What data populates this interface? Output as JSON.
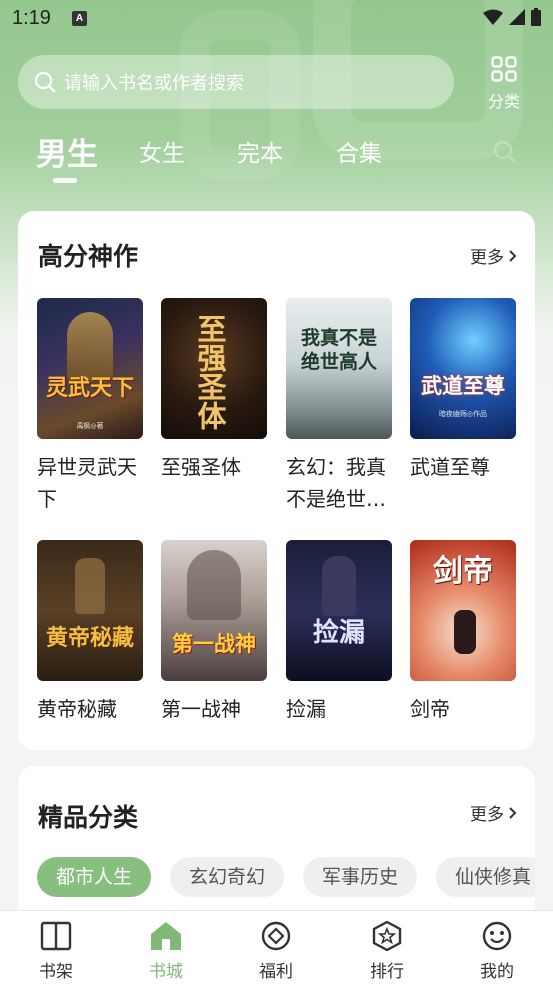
{
  "status": {
    "time": "1:19",
    "notif": "A"
  },
  "search": {
    "placeholder": "请输入书名或作者搜索"
  },
  "category_button": {
    "label": "分类"
  },
  "tabs": [
    {
      "label": "男生",
      "active": true
    },
    {
      "label": "女生",
      "active": false
    },
    {
      "label": "完本",
      "active": false
    },
    {
      "label": "合集",
      "active": false
    }
  ],
  "high_score": {
    "title": "高分神作",
    "more": "更多",
    "books": [
      {
        "title": "异世灵武天下",
        "cover_text": "灵武天下",
        "cover_author": "禹枫◎著"
      },
      {
        "title": "至强圣体",
        "cover_text": "至强圣体",
        "cover_author": ""
      },
      {
        "title": "玄幻：我真不是绝世高人",
        "cover_text": "我真不是绝世高人",
        "cover_author": ""
      },
      {
        "title": "武道至尊",
        "cover_text": "武道至尊",
        "cover_author": "暗夜幽殇◎作品"
      },
      {
        "title": "黄帝秘藏",
        "cover_text": "黄帝秘藏",
        "cover_author": ""
      },
      {
        "title": "第一战神",
        "cover_text": "第一战神",
        "cover_author": ""
      },
      {
        "title": "捡漏",
        "cover_text": "捡漏",
        "cover_author": ""
      },
      {
        "title": "剑帝",
        "cover_text": "剑帝",
        "cover_author": ""
      }
    ]
  },
  "genres": {
    "title": "精品分类",
    "more": "更多",
    "chips": [
      {
        "label": "都市人生",
        "active": true
      },
      {
        "label": "玄幻奇幻",
        "active": false
      },
      {
        "label": "军事历史",
        "active": false
      },
      {
        "label": "仙侠修真",
        "active": false
      }
    ]
  },
  "bottom_nav": [
    {
      "label": "书架",
      "icon": "book-icon",
      "active": false
    },
    {
      "label": "书城",
      "icon": "home-icon",
      "active": true
    },
    {
      "label": "福利",
      "icon": "diamond-icon",
      "active": false
    },
    {
      "label": "排行",
      "icon": "rank-star-icon",
      "active": false
    },
    {
      "label": "我的",
      "icon": "smiley-icon",
      "active": false
    }
  ],
  "colors": {
    "accent": "#7fb877",
    "chip_active": "#86bf7e",
    "header_green": "#94c78e"
  }
}
